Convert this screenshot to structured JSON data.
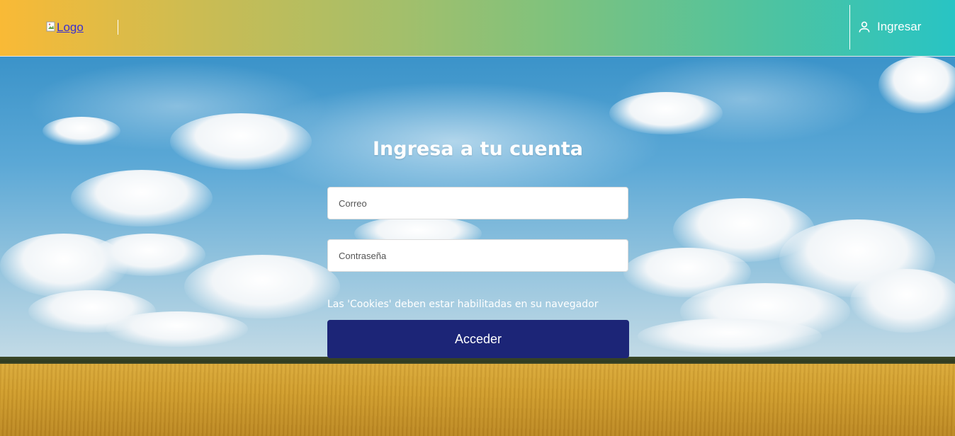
{
  "header": {
    "logo_alt": "Logo",
    "login_label": "Ingresar",
    "login_icon": "user-icon"
  },
  "login": {
    "title": "Ingresa a tu cuenta",
    "email_placeholder": "Correo",
    "password_placeholder": "Contraseña",
    "cookie_note": "Las 'Cookies' deben estar habilitadas en su navegador",
    "submit_label": "Acceder"
  },
  "colors": {
    "header_gradient_start": "#f9ba36",
    "header_gradient_end": "#28c4c4",
    "submit_button": "#1c2577",
    "text_light": "#ffffff"
  }
}
